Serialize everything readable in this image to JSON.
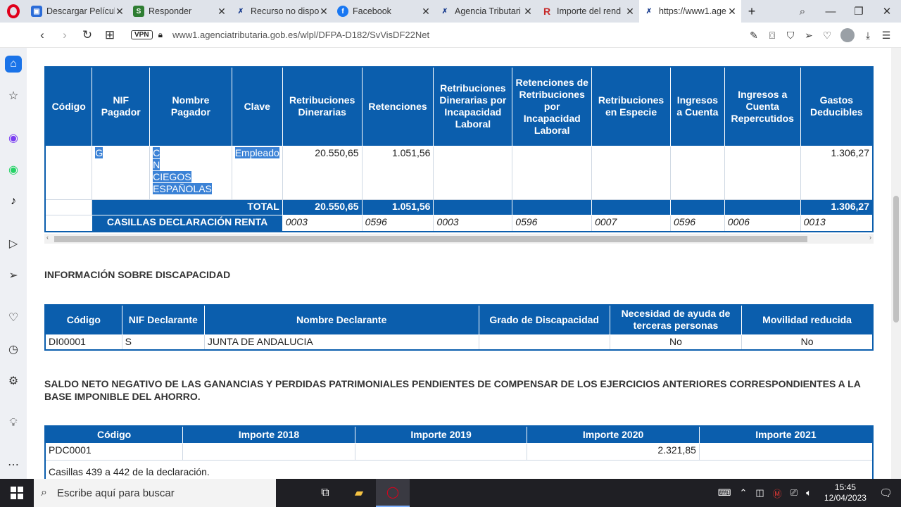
{
  "tabs": [
    {
      "title": "Descargar Películ",
      "favicon_color": "#2b6cd8",
      "favicon_glyph": "⬛"
    },
    {
      "title": "Responder",
      "favicon_color": "#2e7d32",
      "favicon_glyph": "SD"
    },
    {
      "title": "Recurso no dispo",
      "favicon_color": "#ffffff",
      "favicon_glyph": "✗"
    },
    {
      "title": "Facebook",
      "favicon_color": "#1877f2",
      "favicon_glyph": "f"
    },
    {
      "title": "Agencia Tributari",
      "favicon_color": "#ffffff",
      "favicon_glyph": "✗"
    },
    {
      "title": "Importe del rend",
      "favicon_color": "#ffffff",
      "favicon_glyph": "R"
    },
    {
      "title": "https://www1.age",
      "favicon_color": "#ffffff",
      "favicon_glyph": "✗"
    }
  ],
  "address": {
    "url": "www1.agenciatributaria.gob.es/wlpl/DFPA-D182/SvVisDF22Net",
    "vpn_label": "VPN"
  },
  "table_retribuciones": {
    "headers": [
      "Código",
      "NIF Pagador",
      "Nombre Pagador",
      "Clave",
      "Retribuciones Dinerarias",
      "Retenciones",
      "Retribuciones Dinerarias por Incapacidad Laboral",
      "Retenciones de Retribuciones por Incapacidad Laboral",
      "Retribuciones en Especie",
      "Ingresos a Cuenta",
      "Ingresos a Cuenta Repercutidos",
      "Gastos Deducibles"
    ],
    "row": {
      "nif": "G",
      "nombre_lines": [
        "C",
        "N",
        "CIEGOS",
        "ESPAÑOLAS"
      ],
      "clave": "Empleado",
      "retribuciones": "20.550,65",
      "retenciones": "1.051,56",
      "gastos": "1.306,27"
    },
    "total": {
      "label": "TOTAL",
      "retribuciones": "20.550,65",
      "retenciones": "1.051,56",
      "gastos": "1.306,27"
    },
    "casillas": {
      "label": "CASILLAS DECLARACIÓN RENTA",
      "values": [
        "0003",
        "0596",
        "0003",
        "0596",
        "0007",
        "0596",
        "0006",
        "0013"
      ]
    }
  },
  "discapacidad": {
    "title": "INFORMACIÓN SOBRE DISCAPACIDAD",
    "headers": [
      "Código",
      "NIF Declarante",
      "Nombre Declarante",
      "Grado de Discapacidad",
      "Necesidad de ayuda de terceras personas",
      "Movilidad reducida"
    ],
    "row": {
      "codigo": "DI00001",
      "nif": "S",
      "nombre": "JUNTA DE ANDALUCIA",
      "grado": "",
      "ayuda": "No",
      "movilidad": "No"
    }
  },
  "saldo": {
    "title": "SALDO NETO NEGATIVO DE LAS GANANCIAS Y PERDIDAS PATRIMONIALES PENDIENTES DE COMPENSAR DE LOS EJERCICIOS ANTERIORES CORRESPONDIENTES A LA BASE IMPONIBLE DEL AHORRO.",
    "headers": [
      "Código",
      "Importe 2018",
      "Importe 2019",
      "Importe 2020",
      "Importe 2021"
    ],
    "row": {
      "codigo": "PDC0001",
      "i2018": "",
      "i2019": "",
      "i2020": "2.321,85",
      "i2021": ""
    },
    "note": "Casillas 439 a 442 de la declaración."
  },
  "taskbar": {
    "search_placeholder": "Escribe aquí para buscar",
    "time": "15:45",
    "date": "12/04/2023"
  },
  "colors": {
    "header_blue": "#0b5ead",
    "selection": "#3b82d6"
  }
}
